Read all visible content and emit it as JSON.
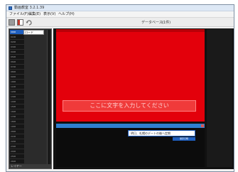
{
  "window": {
    "title": "動画教室 3.2.1.39"
  },
  "menu": [
    "ファイル(F)",
    "編集(E)",
    "表示(V)",
    "ヘルプ(H)"
  ],
  "toolbar": {
    "db_label": "データベース:",
    "db_value": "(1件)"
  },
  "left_panel": {
    "header_label": "ロード",
    "rows": [
      "0000",
      "0100",
      "0200",
      "0300",
      "0400",
      "0500",
      "0600",
      "0700",
      "0800",
      "0900",
      "1000",
      "1100",
      "1200",
      "1300",
      "1400",
      "1500",
      "1600",
      "1700",
      "1800",
      "1900",
      "2000",
      "2100",
      "2200",
      "2300",
      "2400",
      "2500",
      "2600"
    ],
    "footer": "レイヤー"
  },
  "editor": {
    "tiny_label": "",
    "placeholder": "ここに文字を入力してください",
    "subtitle_bar": "",
    "input_text": "明日、札幌のデートの後へ定期",
    "small_button": "保存日時"
  },
  "colors": {
    "canvas_red": "#e3000b",
    "accent_blue": "#1f5fbf",
    "dark_bg": "#111111"
  }
}
